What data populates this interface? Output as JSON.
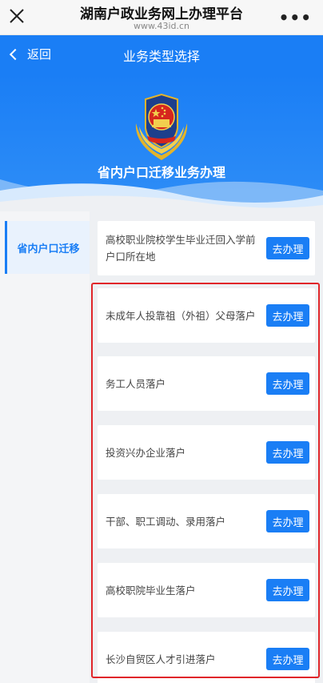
{
  "browser": {
    "title": "湖南户政业务网上办理平台",
    "url": "www.43id.cn",
    "more": "•••"
  },
  "header": {
    "back_label": "返回",
    "title": "业务类型选择",
    "accent_color": "#1a7ef5"
  },
  "banner": {
    "title": "省内户口迁移业务办理"
  },
  "sidebar": {
    "items": [
      {
        "label": "省内户口迁移",
        "active": true
      }
    ]
  },
  "services": {
    "button_label": "去办理",
    "items": [
      {
        "label": "高校职业院校学生毕业迁回入学前户口所在地"
      },
      {
        "label": "未成年人投靠祖（外祖）父母落户"
      },
      {
        "label": "务工人员落户"
      },
      {
        "label": "投资兴办企业落户"
      },
      {
        "label": "干部、职工调动、录用落户"
      },
      {
        "label": "高校职院毕业生落户"
      },
      {
        "label": "长沙自贸区人才引进落户"
      }
    ]
  }
}
